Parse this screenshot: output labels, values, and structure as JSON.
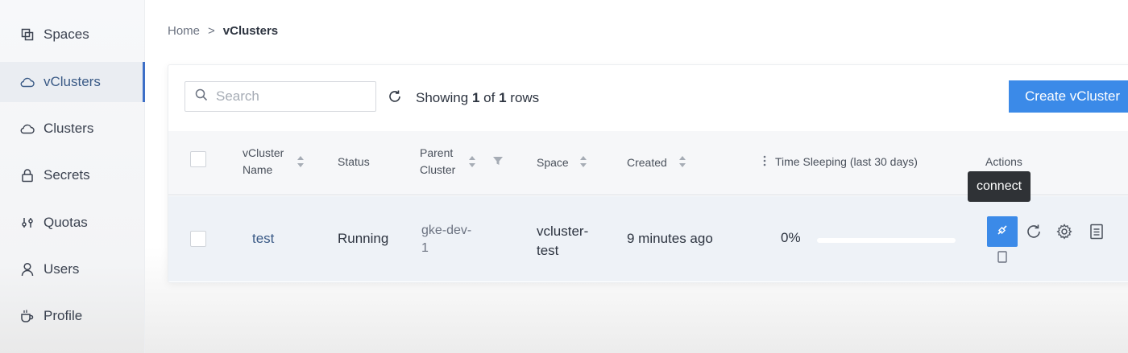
{
  "sidebar": {
    "items": [
      {
        "label": "Spaces",
        "icon": "spaces-icon"
      },
      {
        "label": "vClusters",
        "icon": "cloud-icon",
        "active": true
      },
      {
        "label": "Clusters",
        "icon": "cloud-outline-icon"
      },
      {
        "label": "Secrets",
        "icon": "lock-icon"
      },
      {
        "label": "Quotas",
        "icon": "sliders-icon"
      },
      {
        "label": "Users",
        "icon": "user-icon"
      },
      {
        "label": "Profile",
        "icon": "coffee-icon"
      }
    ]
  },
  "breadcrumb": {
    "home": "Home",
    "separator": ">",
    "current": "vClusters"
  },
  "toolbar": {
    "search_placeholder": "Search",
    "showing_prefix": "Showing",
    "showing_count": "1",
    "showing_of": "of",
    "showing_total": "1",
    "showing_suffix": "rows",
    "create_label": "Create vCluster"
  },
  "table": {
    "headers": {
      "name_line1": "vCluster",
      "name_line2": "Name",
      "status": "Status",
      "parent_line1": "Parent",
      "parent_line2": "Cluster",
      "space": "Space",
      "created": "Created",
      "sleeping": "Time Sleeping (last 30 days)",
      "actions": "Actions"
    },
    "rows": [
      {
        "name": "test",
        "status": "Running",
        "parent_line1": "gke-dev-",
        "parent_line2": "1",
        "space_line1": "vcluster-",
        "space_line2": "test",
        "created": "9 minutes ago",
        "sleeping_percent": "0%",
        "sleeping_fraction": 0
      }
    ]
  },
  "tooltip": {
    "label": "connect"
  },
  "colors": {
    "accent": "#3b8ae8",
    "active_nav": "#3d6fc7"
  }
}
